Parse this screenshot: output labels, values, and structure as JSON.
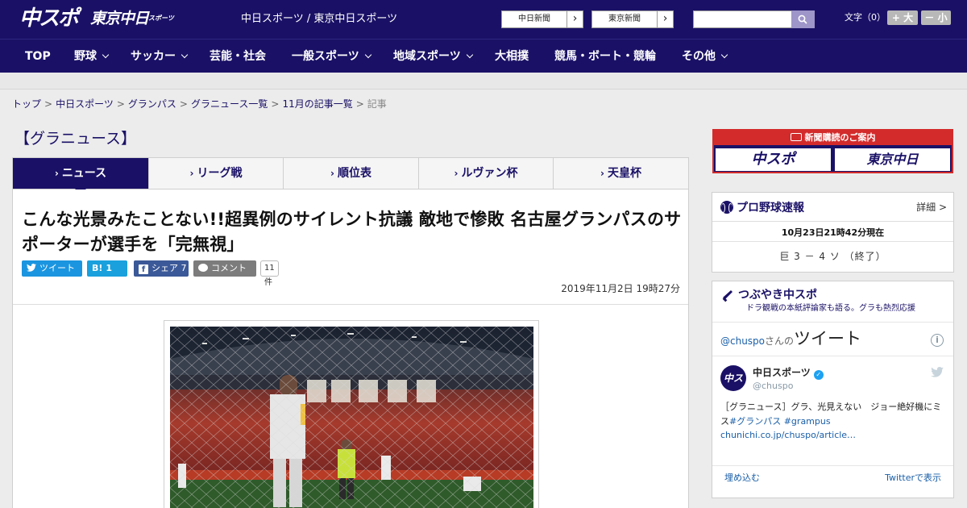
{
  "header": {
    "logo_chuspo": "中スポ",
    "logo_tokyo": "東京中日",
    "logo_tokyo_small": "スポーツ",
    "site_name": "中日スポーツ / 東京中日スポーツ",
    "paper_links": [
      {
        "label": "中日新聞"
      },
      {
        "label": "東京新聞"
      }
    ],
    "search_placeholder": "",
    "font_size_label": "文字（0）",
    "font_larger": "+ 大",
    "font_smaller": "－ 小"
  },
  "nav": {
    "items": [
      {
        "label": "TOP"
      },
      {
        "label": "野球"
      },
      {
        "label": "サッカー"
      },
      {
        "label": "芸能・社会"
      },
      {
        "label": "一般スポーツ"
      },
      {
        "label": "地域スポーツ"
      },
      {
        "label": "大相撲"
      },
      {
        "label": "競馬・ボート・競輪"
      },
      {
        "label": "その他"
      }
    ]
  },
  "breadcrumb": {
    "items": [
      "トップ",
      "中日スポーツ",
      "グランパス",
      "グラニュース一覧",
      "11月の記事一覧"
    ],
    "separator": ">",
    "current": "記事"
  },
  "section": {
    "title": "【グラニュース】"
  },
  "tabs": [
    {
      "label": "ニュース",
      "active": true
    },
    {
      "label": "リーグ戦"
    },
    {
      "label": "順位表"
    },
    {
      "label": "ルヴァン杯"
    },
    {
      "label": "天皇杯"
    }
  ],
  "article": {
    "headline": "こんな光景みたことない!!超異例のサイレント抗議 敵地で惨敗 名古屋グランパスのサポーターが選手を「完無視」",
    "share": {
      "tweet_label": "ツイート",
      "hatena_icon": "B!",
      "hatena_count": "1",
      "facebook_label": "シェア",
      "facebook_count": "7",
      "comment_label": "コメント",
      "comment_count": "11件"
    },
    "published": "2019年11月2日 19時27分"
  },
  "sidebar": {
    "subscribe": {
      "heading": "新聞購読のご案内",
      "logo_chuspo": "中スポ",
      "logo_tokyo": "東京中日"
    },
    "baseball": {
      "title": "プロ野球速報",
      "detail_label": "詳細 >",
      "updated": "10月23日21時42分現在",
      "score": "巨 3 － 4 ソ （終了）"
    },
    "tsubuyaki": {
      "title": "つぶやき中スポ",
      "subtitle": "ドラ観戦の本紙評論家も語る。グラも熱烈応援",
      "widget": {
        "handle": "@chuspo",
        "san": "さんの",
        "tweet_word": "ツイート",
        "avatar_text": "中スポ",
        "name": "中日スポーツ",
        "screen_name": "@chuspo",
        "text": "［グラニュース］グラ、光見えない　ジョー絶好機にミス",
        "tags": [
          "#グランパス",
          "#grampus"
        ],
        "link": "chunichi.co.jp/chuspo/article…",
        "embed_label": "埋め込む",
        "view_label": "Twitterで表示"
      }
    }
  },
  "colors": {
    "brand_navy": "#1a1166",
    "accent_red": "#d32b2b",
    "twitter_blue": "#1b95e0",
    "facebook_blue": "#3b5998"
  },
  "icons": {
    "search": "search-icon",
    "chevron": "chevron-down-icon",
    "baseball": "baseball-icon",
    "megaphone": "megaphone-icon",
    "twitter_bird": "twitter-bird-icon",
    "info": "info-icon"
  }
}
